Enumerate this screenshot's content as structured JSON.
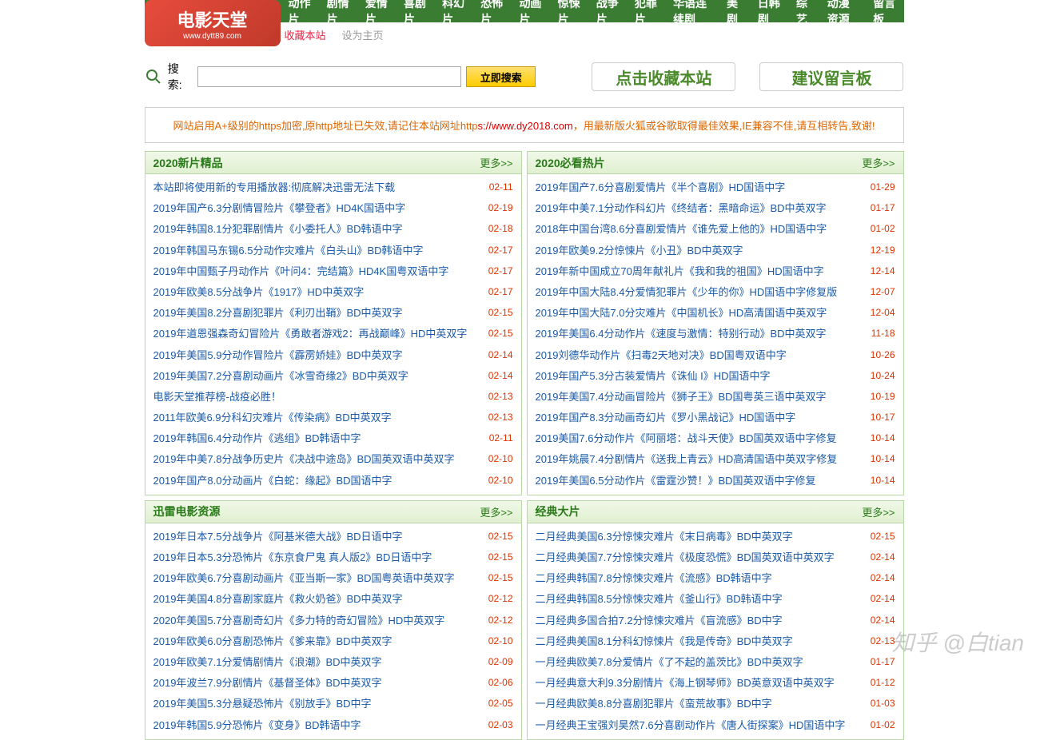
{
  "logo": {
    "text": "电影天堂",
    "url": "www.dytt89.com"
  },
  "nav": [
    "动作片",
    "剧情片",
    "爱情片",
    "喜剧片",
    "科幻片",
    "恐怖片",
    "动画片",
    "惊悚片",
    "战争片",
    "犯罪片",
    "华语连续剧",
    "美剧",
    "日韩剧",
    "综艺",
    "动漫资源",
    "留言板"
  ],
  "subnav": {
    "fav": "收藏本站",
    "home": "设为主页"
  },
  "search": {
    "label": "搜索:",
    "btn": "立即搜索"
  },
  "bigbtns": {
    "fav": "点击收藏本站",
    "board": "建议留言板"
  },
  "notice": {
    "p1": "网站启用A+级别的https加密,原http地址已失效,请记住本站网址http",
    "p2": "s://www.dy2018.com",
    "p3": "，用最新版火狐或谷歌取得最佳效果,IE兼容不佳,请互相转告,致谢!"
  },
  "panels": [
    {
      "title": "2020新片精品",
      "more": "更多>>",
      "items": [
        {
          "t": "本站即将使用新的专用播放器:彻底解决迅雷无法下载",
          "d": "02-11"
        },
        {
          "t": "2019年国产6.3分剧情冒险片《攀登者》HD4K国语中字",
          "d": "02-19"
        },
        {
          "t": "2019年韩国8.1分犯罪剧情片《小委托人》BD韩语中字",
          "d": "02-18"
        },
        {
          "t": "2019年韩国马东锡6.5分动作灾难片《白头山》BD韩语中字",
          "d": "02-17"
        },
        {
          "t": "2019年中国甄子丹动作片《叶问4：完结篇》HD4K国粤双语中字",
          "d": "02-17"
        },
        {
          "t": "2019年欧美8.5分战争片《1917》HD中英双字",
          "d": "02-17"
        },
        {
          "t": "2019年美国8.2分喜剧犯罪片《利刃出鞘》BD中英双字",
          "d": "02-15"
        },
        {
          "t": "2019年道恩强森奇幻冒险片《勇敢者游戏2：再战巅峰》HD中英双字",
          "d": "02-15"
        },
        {
          "t": "2019年美国5.9分动作冒险片《霹雳娇娃》BD中英双字",
          "d": "02-14"
        },
        {
          "t": "2019年美国7.2分喜剧动画片《冰雪奇缘2》BD中英双字",
          "d": "02-14"
        },
        {
          "t": "电影天堂推荐榜-战疫必胜！",
          "d": "02-13"
        },
        {
          "t": "2011年欧美6.9分科幻灾难片《传染病》BD中英双字",
          "d": "02-13"
        },
        {
          "t": "2019年韩国6.4分动作片《逃组》BD韩语中字",
          "d": "02-11"
        },
        {
          "t": "2019年中美7.8分战争历史片《决战中途岛》BD国英双语中英双字",
          "d": "02-10"
        },
        {
          "t": "2019年国产8.0分动画片《白蛇：缘起》BD国语中字",
          "d": "02-10"
        }
      ]
    },
    {
      "title": "2020必看热片",
      "more": "更多>>",
      "items": [
        {
          "t": "2019年国产7.6分喜剧爱情片《半个喜剧》HD国语中字",
          "d": "01-29"
        },
        {
          "t": "2019年中美7.1分动作科幻片《终结者：黑暗命运》BD中英双字",
          "d": "01-17"
        },
        {
          "t": "2018年中国台湾8.6分喜剧爱情片《谁先爱上他的》HD国语中字",
          "d": "01-02"
        },
        {
          "t": "2019年欧美9.2分惊悚片《小丑》BD中英双字",
          "d": "12-19"
        },
        {
          "t": "2019年新中国成立70周年献礼片《我和我的祖国》HD国语中字",
          "d": "12-14"
        },
        {
          "t": "2019年中国大陆8.4分爱情犯罪片《少年的你》HD国语中字修复版",
          "d": "12-07"
        },
        {
          "t": "2019年中国大陆7.0分灾难片《中国机长》HD高清国语中英双字",
          "d": "12-04"
        },
        {
          "t": "2019年美国6.4分动作片《速度与激情：特别行动》BD中英双字",
          "d": "11-18"
        },
        {
          "t": "2019刘德华动作片《扫毒2天地对决》BD国粤双语中字",
          "d": "10-26"
        },
        {
          "t": "2019年国产5.3分古装爱情片《诛仙 I》HD国语中字",
          "d": "10-24"
        },
        {
          "t": "2019年美国7.4分动画冒险片《狮子王》BD国粤英三语中英双字",
          "d": "10-19"
        },
        {
          "t": "2019年国产8.3分动画奇幻片《罗小黑战记》HD国语中字",
          "d": "10-17"
        },
        {
          "t": "2019美国7.6分动作片《阿丽塔：战斗天使》BD国英双语中字修复",
          "d": "10-14"
        },
        {
          "t": "2019年姚晨7.4分剧情片《送我上青云》HD高清国语中英双字修复",
          "d": "10-14"
        },
        {
          "t": "2019年美国6.5分动作片《雷霆沙赞！》BD国英双语中字修复",
          "d": "10-14"
        }
      ]
    },
    {
      "title": "迅雷电影资源",
      "more": "更多>>",
      "items": [
        {
          "t": "2019年日本7.5分战争片《阿基米德大战》BD日语中字",
          "d": "02-15"
        },
        {
          "t": "2019年日本5.3分恐怖片《东京食尸鬼 真人版2》BD日语中字",
          "d": "02-15"
        },
        {
          "t": "2019年欧美6.7分喜剧动画片《亚当斯一家》BD国粤英语中英双字",
          "d": "02-15"
        },
        {
          "t": "2019年美国4.8分喜剧家庭片《救火奶爸》BD中英双字",
          "d": "02-12"
        },
        {
          "t": "2020年美国5.7分喜剧奇幻片《多力特的奇幻冒险》HD中英双字",
          "d": "02-12"
        },
        {
          "t": "2019年欧美6.0分喜剧恐怖片《爹来靠》BD中英双字",
          "d": "02-10"
        },
        {
          "t": "2019年欧美7.1分爱情剧情片《浪潮》BD中英双字",
          "d": "02-09"
        },
        {
          "t": "2019年波兰7.9分剧情片《基督圣体》BD中英双字",
          "d": "02-06"
        },
        {
          "t": "2019年美国5.3分悬疑恐怖片《别放手》BD中字",
          "d": "02-05"
        },
        {
          "t": "2019年韩国5.9分恐怖片《变身》BD韩语中字",
          "d": "02-03"
        }
      ]
    },
    {
      "title": "经典大片",
      "more": "更多>>",
      "items": [
        {
          "t": "二月经典美国6.3分惊悚灾难片《末日病毒》BD中英双字",
          "d": "02-15"
        },
        {
          "t": "二月经典美国7.7分惊悚灾难片《极度恐慌》BD国英双语中英双字",
          "d": "02-14"
        },
        {
          "t": "二月经典韩国7.8分惊悚灾难片《流感》BD韩语中字",
          "d": "02-14"
        },
        {
          "t": "二月经典韩国8.5分惊悚灾难片《釜山行》BD韩语中字",
          "d": "02-14"
        },
        {
          "t": "二月经典多国合拍7.2分惊悚灾难片《盲流感》BD中字",
          "d": "02-14"
        },
        {
          "t": "二月经典美国8.1分科幻惊悚片《我是传奇》BD中英双字",
          "d": "02-13"
        },
        {
          "t": "一月经典欧美7.8分爱情片《了不起的盖茨比》BD中英双字",
          "d": "01-17"
        },
        {
          "t": "一月经典意大利9.3分剧情片《海上钢琴师》BD英意双语中英双字",
          "d": "01-12"
        },
        {
          "t": "一月经典欧美8.8分喜剧犯罪片《蛮荒故事》BD中字",
          "d": "01-03"
        },
        {
          "t": "一月经典王宝强刘昊然7.6分喜剧动作片《唐人街探案》HD国语中字",
          "d": "01-02"
        }
      ]
    }
  ],
  "watermark": "知乎 @白tian"
}
